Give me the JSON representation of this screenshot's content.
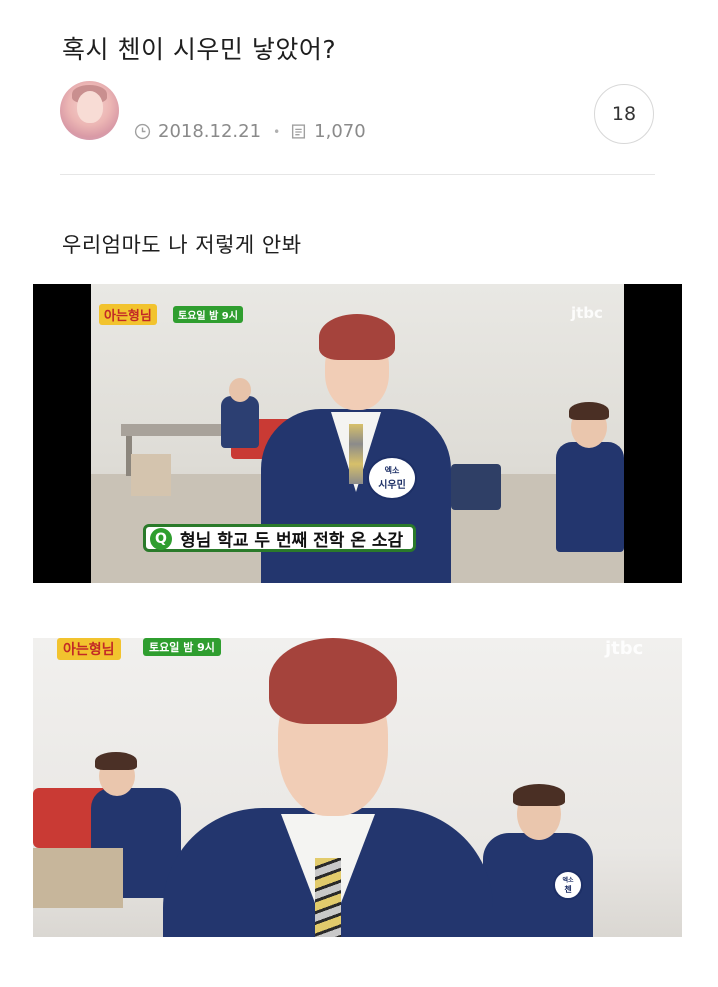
{
  "post": {
    "title": "혹시 첸이 시우민 낳았어?",
    "date": "2018.12.21",
    "views": "1,070",
    "comment_count": "18",
    "body_text": "우리엄마도 나 저렇게 안봐"
  },
  "icons": {
    "clock": "clock-icon",
    "views": "document-icon"
  },
  "images": [
    {
      "show_logo": "아는형님",
      "show_time": "토요일 밤 9시",
      "broadcaster": "jtbc",
      "caption": "형님 학교 두 번째 전학 온 소감",
      "caption_icon": "Q",
      "nametag_top": "엑소",
      "nametag_main": "시우민"
    },
    {
      "show_logo": "아는형님",
      "show_time": "토요일 밤 9시",
      "broadcaster": "jtbc",
      "nametag_top": "엑소",
      "nametag_main": "첸"
    }
  ],
  "colors": {
    "accent_green": "#2f9e2f",
    "uniform_navy": "#23366e",
    "hair_red": "#a5433c",
    "meta_gray": "#8a8a8a"
  }
}
